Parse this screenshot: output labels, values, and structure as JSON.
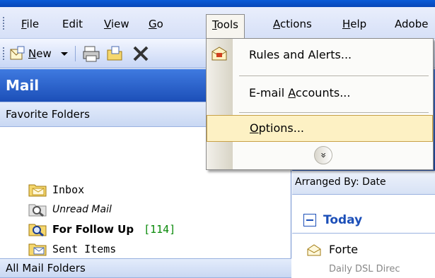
{
  "menubar": {
    "items": [
      {
        "pre": "",
        "acc": "F",
        "post": "ile"
      },
      {
        "pre": "Edit",
        "acc": "",
        "post": ""
      },
      {
        "pre": "",
        "acc": "V",
        "post": "iew"
      },
      {
        "pre": "",
        "acc": "G",
        "post": "o"
      },
      {
        "pre": "",
        "acc": "T",
        "post": "ools"
      },
      {
        "pre": "",
        "acc": "A",
        "post": "ctions"
      },
      {
        "pre": "",
        "acc": "H",
        "post": "elp"
      },
      {
        "pre": "Adobe",
        "acc": "",
        "post": ""
      }
    ]
  },
  "toolbar": {
    "new_pre": "",
    "new_acc": "N",
    "new_post": "ew"
  },
  "tools_menu": {
    "rules": "Rules and Alerts...",
    "email_pre": "E-mail ",
    "email_acc": "A",
    "email_post": "ccounts...",
    "options_acc": "O",
    "options_post": "ptions..."
  },
  "navpane": {
    "header": "Mail",
    "favorites_label": "Favorite Folders",
    "all_folders_label": "All Mail Folders",
    "folders": [
      {
        "label": "Inbox",
        "count": ""
      },
      {
        "label": "Unread Mail",
        "count": ""
      },
      {
        "label": "For Follow Up",
        "count": "[114]"
      },
      {
        "label": "Sent Items",
        "count": ""
      }
    ]
  },
  "rightpane": {
    "arranged": "Arranged By: Date",
    "group": "Today",
    "sender": "Forte",
    "preview": "Daily DSL Direc"
  },
  "colors": {
    "menu_highlight": "#fdf1c4",
    "header_blue": "#1c4fb8",
    "count_green": "#0a8a0a"
  }
}
